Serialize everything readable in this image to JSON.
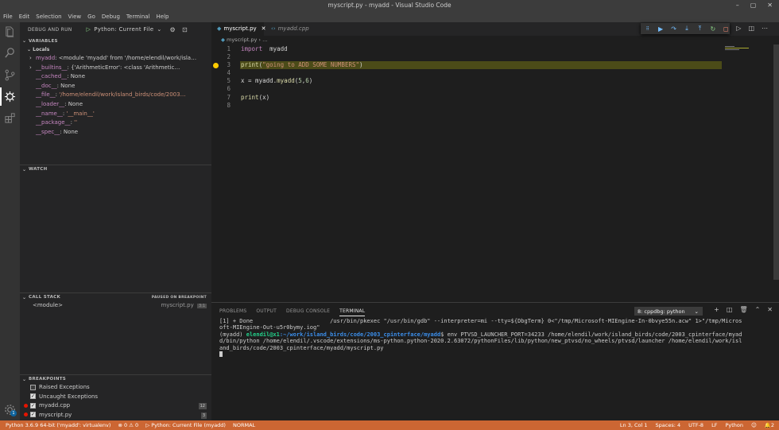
{
  "window": {
    "title": "myscript.py - myadd - Visual Studio Code",
    "buttons": [
      "–",
      "▢",
      "✕"
    ]
  },
  "menu": [
    "File",
    "Edit",
    "Selection",
    "View",
    "Go",
    "Debug",
    "Terminal",
    "Help"
  ],
  "activity_icons": [
    "files-icon",
    "search-icon",
    "source-control-icon",
    "debug-icon",
    "extensions-icon",
    "settings-gear-icon"
  ],
  "settings_badge": "1",
  "sidebar": {
    "title": "DEBUG AND RUN",
    "config": "Python: Current File",
    "variables_title": "VARIABLES",
    "locals_label": "Locals",
    "variables": [
      {
        "expand": "›",
        "name": "myadd",
        "value": " <module 'myadd' from '/home/elendil/work/isla…",
        "kind": "val"
      },
      {
        "expand": "›",
        "name": "__builtins__",
        "value": " {'ArithmeticError': <class 'Arithmetic…",
        "kind": "val"
      },
      {
        "expand": "",
        "name": "__cached__",
        "value": " None",
        "kind": "val"
      },
      {
        "expand": "",
        "name": "__doc__",
        "value": " None",
        "kind": "val"
      },
      {
        "expand": "",
        "name": "__file__",
        "value": " '/home/elendil/work/island_birds/code/2003…",
        "kind": "str"
      },
      {
        "expand": "",
        "name": "__loader__",
        "value": " None",
        "kind": "val"
      },
      {
        "expand": "",
        "name": "__name__",
        "value": " '__main__'",
        "kind": "str"
      },
      {
        "expand": "",
        "name": "__package__",
        "value": " ''",
        "kind": "str"
      },
      {
        "expand": "",
        "name": "__spec__",
        "value": " None",
        "kind": "val"
      }
    ],
    "watch_title": "WATCH",
    "callstack_title": "CALL STACK",
    "callstack_status": "PAUSED ON BREAKPOINT",
    "callstack_frame": "<module>",
    "callstack_file": "myscript.py",
    "callstack_pos": "3:1",
    "breakpoints_title": "BREAKPOINTS",
    "breakpoints": [
      {
        "label": "Raised Exceptions",
        "checked": false,
        "dot": false,
        "count": ""
      },
      {
        "label": "Uncaught Exceptions",
        "checked": true,
        "dot": false,
        "count": ""
      },
      {
        "label": "myadd.cpp",
        "checked": true,
        "dot": true,
        "count": "12"
      },
      {
        "label": "myscript.py",
        "checked": true,
        "dot": true,
        "count": "3"
      }
    ]
  },
  "editor": {
    "tabs": [
      {
        "label": "myscript.py",
        "active": true,
        "icon": "python-icon"
      },
      {
        "label": "myadd.cpp",
        "active": false,
        "icon": "cpp-icon"
      }
    ],
    "breadcrumb": {
      "file": "myscript.py",
      "rest": "…"
    },
    "lines": [
      {
        "n": "1",
        "tokens": [
          [
            "kw",
            "import"
          ],
          [
            "",
            "  myadd"
          ]
        ]
      },
      {
        "n": "2",
        "tokens": []
      },
      {
        "n": "3",
        "tokens": [
          [
            "fn",
            "print"
          ],
          [
            "",
            "("
          ],
          [
            "str",
            "\"going to ADD SOME NUMBERS\""
          ],
          [
            "",
            ")"
          ]
        ],
        "highlight": true
      },
      {
        "n": "4",
        "tokens": []
      },
      {
        "n": "5",
        "tokens": [
          [
            "",
            "x = myadd."
          ],
          [
            "fn",
            "myadd"
          ],
          [
            "",
            "("
          ],
          [
            "num",
            "5"
          ],
          [
            "",
            ","
          ],
          [
            "num",
            "6"
          ],
          [
            "",
            ")"
          ]
        ]
      },
      {
        "n": "6",
        "tokens": []
      },
      {
        "n": "7",
        "tokens": [
          [
            "fn",
            "print"
          ],
          [
            "",
            "(x)"
          ]
        ]
      },
      {
        "n": "8",
        "tokens": []
      }
    ]
  },
  "panel": {
    "tabs": [
      "PROBLEMS",
      "OUTPUT",
      "DEBUG CONSOLE",
      "TERMINAL"
    ],
    "active_tab": "TERMINAL",
    "terminal_select": "8: cppdbg: python",
    "terminal_line1": "[1] + Done                       /usr/bin/pkexec \"/usr/bin/gdb\" --interpreter=mi --tty=${DbgTerm} 0<\"/tmp/Microsoft-MIEngine-In-0bvye55n.acw\" 1>\"/tmp/Microsoft-MIEngine-Out-u5r0bymy.iog\"",
    "terminal_prompt_env": "(myadd) ",
    "terminal_user": "elendil@x1",
    "terminal_path": ":~/work/island_birds/code/2003_cpinterface/myadd",
    "terminal_cmd": "$ env PTVSD_LAUNCHER_PORT=34233 /home/elendil/work/island_birds/code/2003_cpinterface/myadd/bin/python /home/elendil/.vscode/extensions/ms-python.python-2020.2.63072/pythonFiles/lib/python/new_ptvsd/no_wheels/ptvsd/launcher /home/elendil/work/island_birds/code/2003_cpinterface/myadd/myscript.py"
  },
  "statusbar": {
    "interpreter": "Python 3.6.9 64-bit ('myadd': virtualenv)",
    "problems": "⊗ 0  ⚠ 0",
    "debug": "Python: Current File (myadd)",
    "mode": "NORMAL",
    "position": "Ln 3, Col 1",
    "spaces": "Spaces: 4",
    "encoding": "UTF-8",
    "eol": "LF",
    "language": "Python",
    "notifications": "2"
  }
}
